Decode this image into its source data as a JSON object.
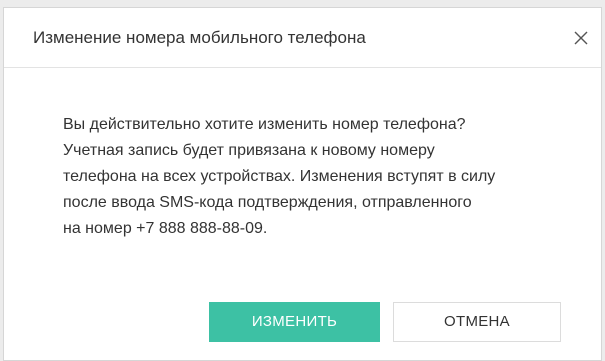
{
  "dialog": {
    "title": "Изменение номера мобильного телефона",
    "close_label": "×",
    "message_lines": [
      "Вы действительно хотите изменить номер телефона?",
      "Учетная запись будет привязана к новому номеру",
      "телефона на всех устройствах. Изменения вступят в силу",
      "после ввода SMS-кода подтверждения, отправленного",
      "на номер +7 888 888-88-09."
    ],
    "confirm_label": "ИЗМЕНИТЬ",
    "cancel_label": "ОТМЕНА"
  },
  "colors": {
    "accent": "#3dc1a4",
    "background": "#ececec",
    "text": "#333333"
  },
  "icons": {
    "close": "close-icon"
  }
}
